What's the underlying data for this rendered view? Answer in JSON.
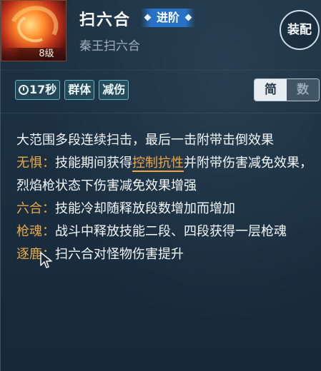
{
  "skill": {
    "level": "8级",
    "title": "扫六合",
    "advance_badge": "进阶",
    "subtitle": "秦王扫六合",
    "equip_label": "装配"
  },
  "tags": [
    "17秒",
    "群体",
    "减伤"
  ],
  "toggle": {
    "simple": "简",
    "numeric": "数",
    "selected": "简"
  },
  "description": {
    "main": "大范围多段连续扫击，最后一击附带击倒效果",
    "effects": [
      {
        "name": "无惧：",
        "pre": "技能期间获得",
        "highlight": "控制抗性",
        "post": "并附带伤害减免效果，烈焰枪状态下伤害减免效果增强"
      },
      {
        "name": "六合：",
        "text": "技能冷却随释放段数增加而增加"
      },
      {
        "name": "枪魂：",
        "text": "战斗中释放技能二段、四段获得一层枪魂"
      },
      {
        "name": "逐鹿：",
        "text": "扫六合对怪物伤害提升"
      }
    ]
  },
  "colors": {
    "keyword": "#e8a94a",
    "tag_border": "#5fb7c6",
    "advance": "#2878d2"
  }
}
